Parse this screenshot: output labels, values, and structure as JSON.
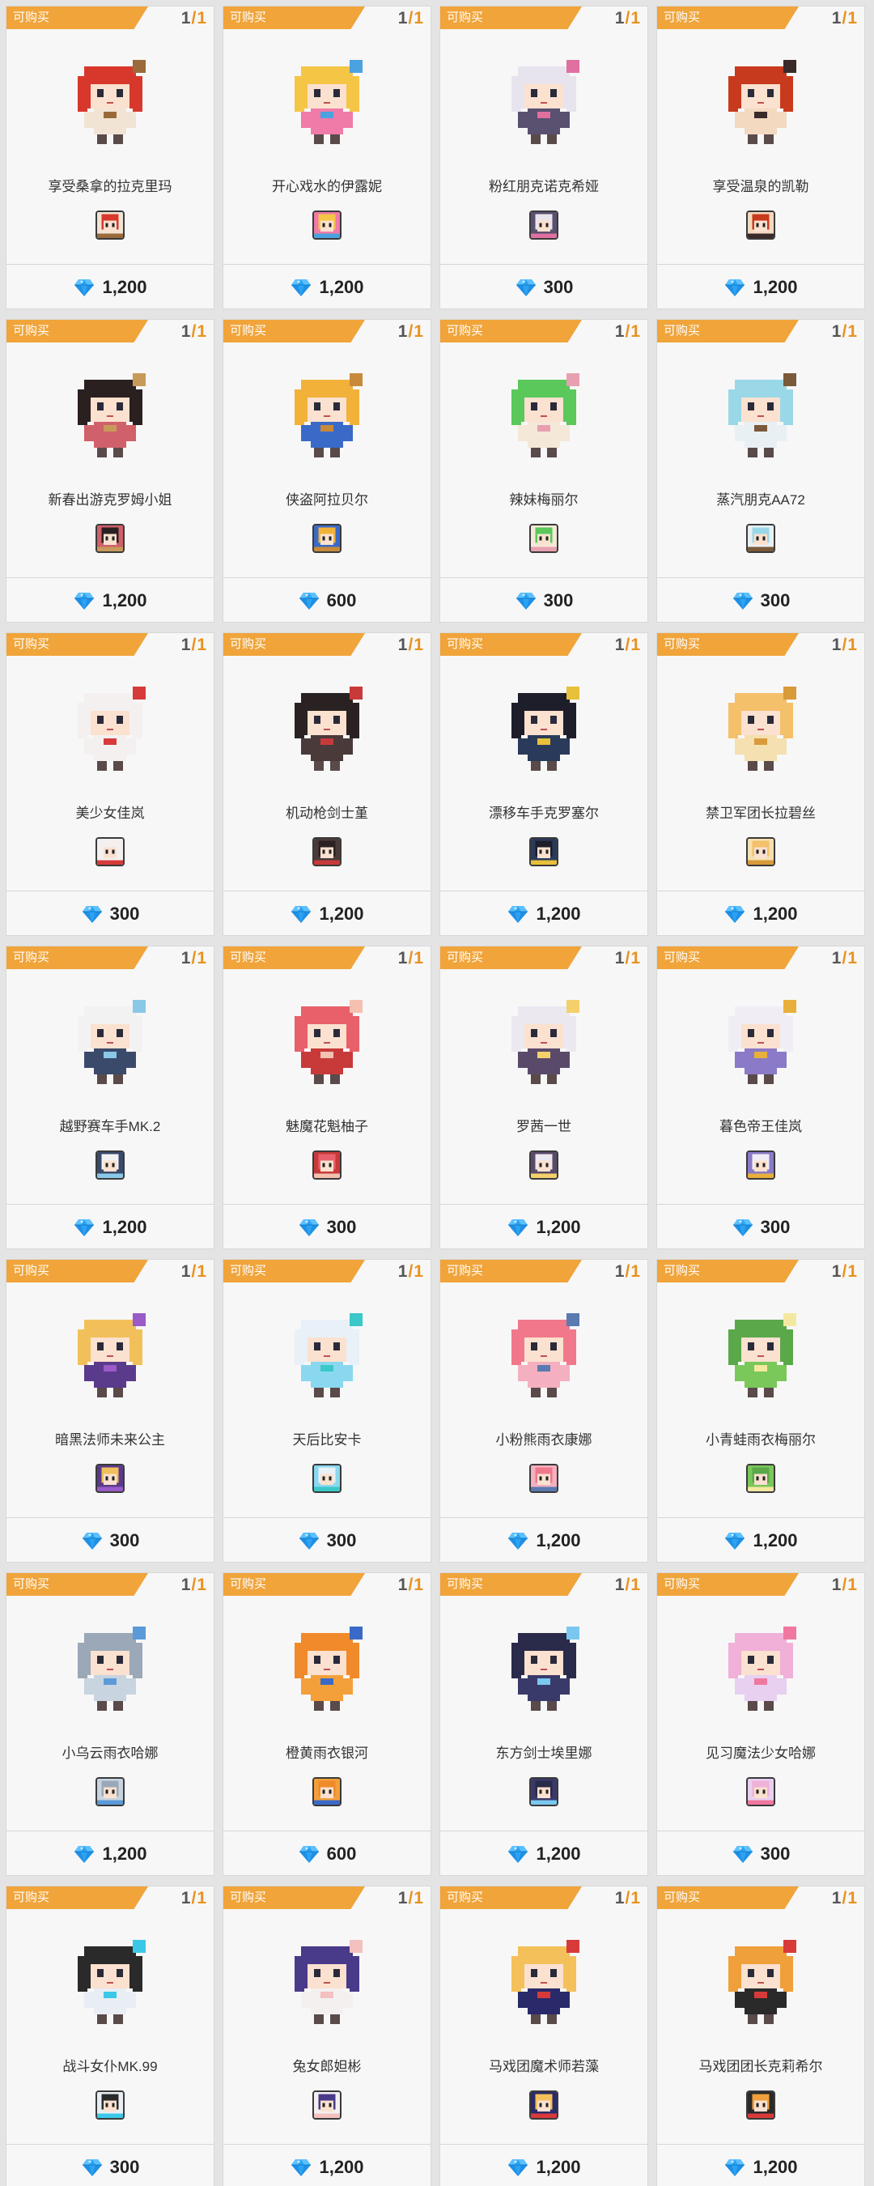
{
  "shop": {
    "items": [
      {
        "status": "可购买",
        "count": "1",
        "max": "1",
        "name": "享受桑拿的拉克里玛",
        "price": "1,200",
        "hair": "#d8382c",
        "outfit": "#f2e4d4",
        "accent": "#9a6a3a"
      },
      {
        "status": "可购买",
        "count": "1",
        "max": "1",
        "name": "开心戏水的伊露妮",
        "price": "1,200",
        "hair": "#f5c646",
        "outfit": "#f07aa8",
        "accent": "#4aa3e0"
      },
      {
        "status": "可购买",
        "count": "1",
        "max": "1",
        "name": "粉红朋克诺克希娅",
        "price": "300",
        "hair": "#e8e4ee",
        "outfit": "#5a5070",
        "accent": "#e070a0"
      },
      {
        "status": "可购买",
        "count": "1",
        "max": "1",
        "name": "享受温泉的凯勒",
        "price": "1,200",
        "hair": "#c83a1e",
        "outfit": "#f3d9c0",
        "accent": "#3a2a2a"
      },
      {
        "status": "可购买",
        "count": "1",
        "max": "1",
        "name": "新春出游克罗姆小姐",
        "price": "1,200",
        "hair": "#2a2020",
        "outfit": "#d0606a",
        "accent": "#c89a5a"
      },
      {
        "status": "可购买",
        "count": "1",
        "max": "1",
        "name": "侠盗阿拉贝尔",
        "price": "600",
        "hair": "#f2b23a",
        "outfit": "#3a6ac8",
        "accent": "#c88a3a"
      },
      {
        "status": "可购买",
        "count": "1",
        "max": "1",
        "name": "辣妹梅丽尔",
        "price": "300",
        "hair": "#5ac85a",
        "outfit": "#f4e8d8",
        "accent": "#e8a0b0"
      },
      {
        "status": "可购买",
        "count": "1",
        "max": "1",
        "name": "蒸汽朋克AA72",
        "price": "300",
        "hair": "#9ad8e8",
        "outfit": "#e8f0f4",
        "accent": "#7a5a3a"
      },
      {
        "status": "可购买",
        "count": "1",
        "max": "1",
        "name": "美少女佳岚",
        "price": "300",
        "hair": "#f4f0f0",
        "outfit": "#f4f0f0",
        "accent": "#d83a3a"
      },
      {
        "status": "可购买",
        "count": "1",
        "max": "1",
        "name": "机动枪剑士堇",
        "price": "1,200",
        "hair": "#2a2222",
        "outfit": "#4a3a3a",
        "accent": "#c83a3a"
      },
      {
        "status": "可购买",
        "count": "1",
        "max": "1",
        "name": "漂移车手克罗塞尔",
        "price": "1,200",
        "hair": "#1e1e2a",
        "outfit": "#2a3a5a",
        "accent": "#e8c03a"
      },
      {
        "status": "可购买",
        "count": "1",
        "max": "1",
        "name": "禁卫军团长拉碧丝",
        "price": "1,200",
        "hair": "#f4c06a",
        "outfit": "#f4e0b0",
        "accent": "#d89a3a"
      },
      {
        "status": "可购买",
        "count": "1",
        "max": "1",
        "name": "越野赛车手MK.2",
        "price": "1,200",
        "hair": "#f2f2f2",
        "outfit": "#3a4a6a",
        "accent": "#8ac8e8"
      },
      {
        "status": "可购买",
        "count": "1",
        "max": "1",
        "name": "魅魔花魁柚子",
        "price": "300",
        "hair": "#e8606a",
        "outfit": "#c83a3a",
        "accent": "#f4c0b0"
      },
      {
        "status": "可购买",
        "count": "1",
        "max": "1",
        "name": "罗茜一世",
        "price": "1,200",
        "hair": "#ece8f0",
        "outfit": "#5a4a6a",
        "accent": "#f4d06a"
      },
      {
        "status": "可购买",
        "count": "1",
        "max": "1",
        "name": "暮色帝王佳岚",
        "price": "300",
        "hair": "#f0eef4",
        "outfit": "#8a7ac8",
        "accent": "#e8b03a"
      },
      {
        "status": "可购买",
        "count": "1",
        "max": "1",
        "name": "暗黑法师未来公主",
        "price": "300",
        "hair": "#f2c05a",
        "outfit": "#5a3a8a",
        "accent": "#9a5ac8"
      },
      {
        "status": "可购买",
        "count": "1",
        "max": "1",
        "name": "天后比安卡",
        "price": "300",
        "hair": "#e8f0f8",
        "outfit": "#8ad8f0",
        "accent": "#3ac8c8"
      },
      {
        "status": "可购买",
        "count": "1",
        "max": "1",
        "name": "小粉熊雨衣康娜",
        "price": "1,200",
        "hair": "#f0788a",
        "outfit": "#f4b0c0",
        "accent": "#5a7ab0"
      },
      {
        "status": "可购买",
        "count": "1",
        "max": "1",
        "name": "小青蛙雨衣梅丽尔",
        "price": "1,200",
        "hair": "#5aa84a",
        "outfit": "#7ac85a",
        "accent": "#f4e8a0"
      },
      {
        "status": "可购买",
        "count": "1",
        "max": "1",
        "name": "小乌云雨衣哈娜",
        "price": "1,200",
        "hair": "#9aa8b8",
        "outfit": "#c8d4e0",
        "accent": "#5a9ad8"
      },
      {
        "status": "可购买",
        "count": "1",
        "max": "1",
        "name": "橙黄雨衣银河",
        "price": "600",
        "hair": "#f08a2a",
        "outfit": "#f4a03a",
        "accent": "#3a6ac8"
      },
      {
        "status": "可购买",
        "count": "1",
        "max": "1",
        "name": "东方剑士埃里娜",
        "price": "1,200",
        "hair": "#2a2a4a",
        "outfit": "#3a3a6a",
        "accent": "#7ac8f0"
      },
      {
        "status": "可购买",
        "count": "1",
        "max": "1",
        "name": "见习魔法少女哈娜",
        "price": "300",
        "hair": "#f0b0d8",
        "outfit": "#e8d0f0",
        "accent": "#f078a0"
      },
      {
        "status": "可购买",
        "count": "1",
        "max": "1",
        "name": "战斗女仆MK.99",
        "price": "300",
        "hair": "#2a2a2a",
        "outfit": "#e8eef4",
        "accent": "#3ac8e8"
      },
      {
        "status": "可购买",
        "count": "1",
        "max": "1",
        "name": "兔女郎妲彬",
        "price": "1,200",
        "hair": "#4a3a8a",
        "outfit": "#f4f0f0",
        "accent": "#f4c0c0"
      },
      {
        "status": "可购买",
        "count": "1",
        "max": "1",
        "name": "马戏团魔术师若藻",
        "price": "1,200",
        "hair": "#f4c05a",
        "outfit": "#2a2a6a",
        "accent": "#d83a3a"
      },
      {
        "status": "可购买",
        "count": "1",
        "max": "1",
        "name": "马戏团团长克莉希尔",
        "price": "1,200",
        "hair": "#f0a03a",
        "outfit": "#2a2a2a",
        "accent": "#d83a3a"
      }
    ]
  }
}
